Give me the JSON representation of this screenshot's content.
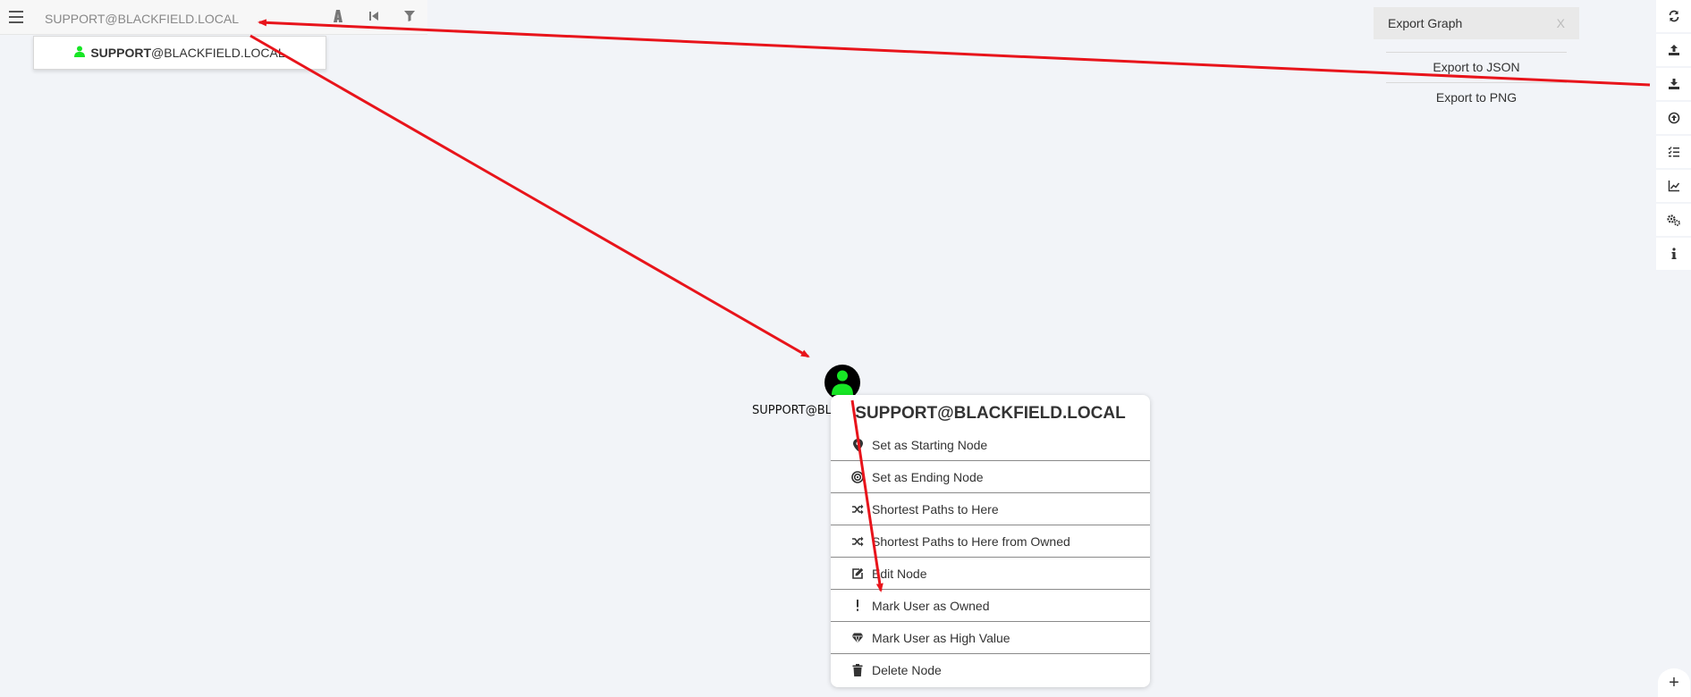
{
  "search": {
    "value": "SUPPORT@BLACKFIELD.LOCAL",
    "suggestion_bold": "SUPPORT",
    "suggestion_rest": "@BLACKFIELD.LOCAL"
  },
  "icons": {
    "menu": "hamburger-icon",
    "pathfinding": "road-icon",
    "back": "step-backward-icon",
    "filter": "filter-icon",
    "user": "user-icon"
  },
  "export": {
    "title": "Export Graph",
    "close": "X",
    "items": [
      "Export to JSON",
      "Export to PNG"
    ]
  },
  "right_toolbar": [
    "refresh-icon",
    "upload-icon",
    "download-icon",
    "import-icon",
    "query-list-icon",
    "chart-icon",
    "settings-icon",
    "info-icon"
  ],
  "zoom_button": "+",
  "node": {
    "label": "SUPPORT@BLA",
    "color_user": "#17e625"
  },
  "context_menu": {
    "title": "SUPPORT@BLACKFIELD.LOCAL",
    "items": [
      {
        "label": "Set as Starting Node",
        "icon": "map-marker-icon"
      },
      {
        "label": "Set as Ending Node",
        "icon": "target-icon"
      },
      {
        "label": "Shortest Paths to Here",
        "icon": "shuffle-icon"
      },
      {
        "label": "Shortest Paths to Here from Owned",
        "icon": "shuffle-icon"
      },
      {
        "label": "Edit Node",
        "icon": "edit-icon"
      },
      {
        "label": "Mark User as Owned",
        "icon": "exclamation-icon"
      },
      {
        "label": "Mark User as High Value",
        "icon": "gem-icon"
      },
      {
        "label": "Delete Node",
        "icon": "trash-icon"
      }
    ]
  },
  "colors": {
    "arrow": "#e8141b",
    "background": "#f2f4f8"
  }
}
